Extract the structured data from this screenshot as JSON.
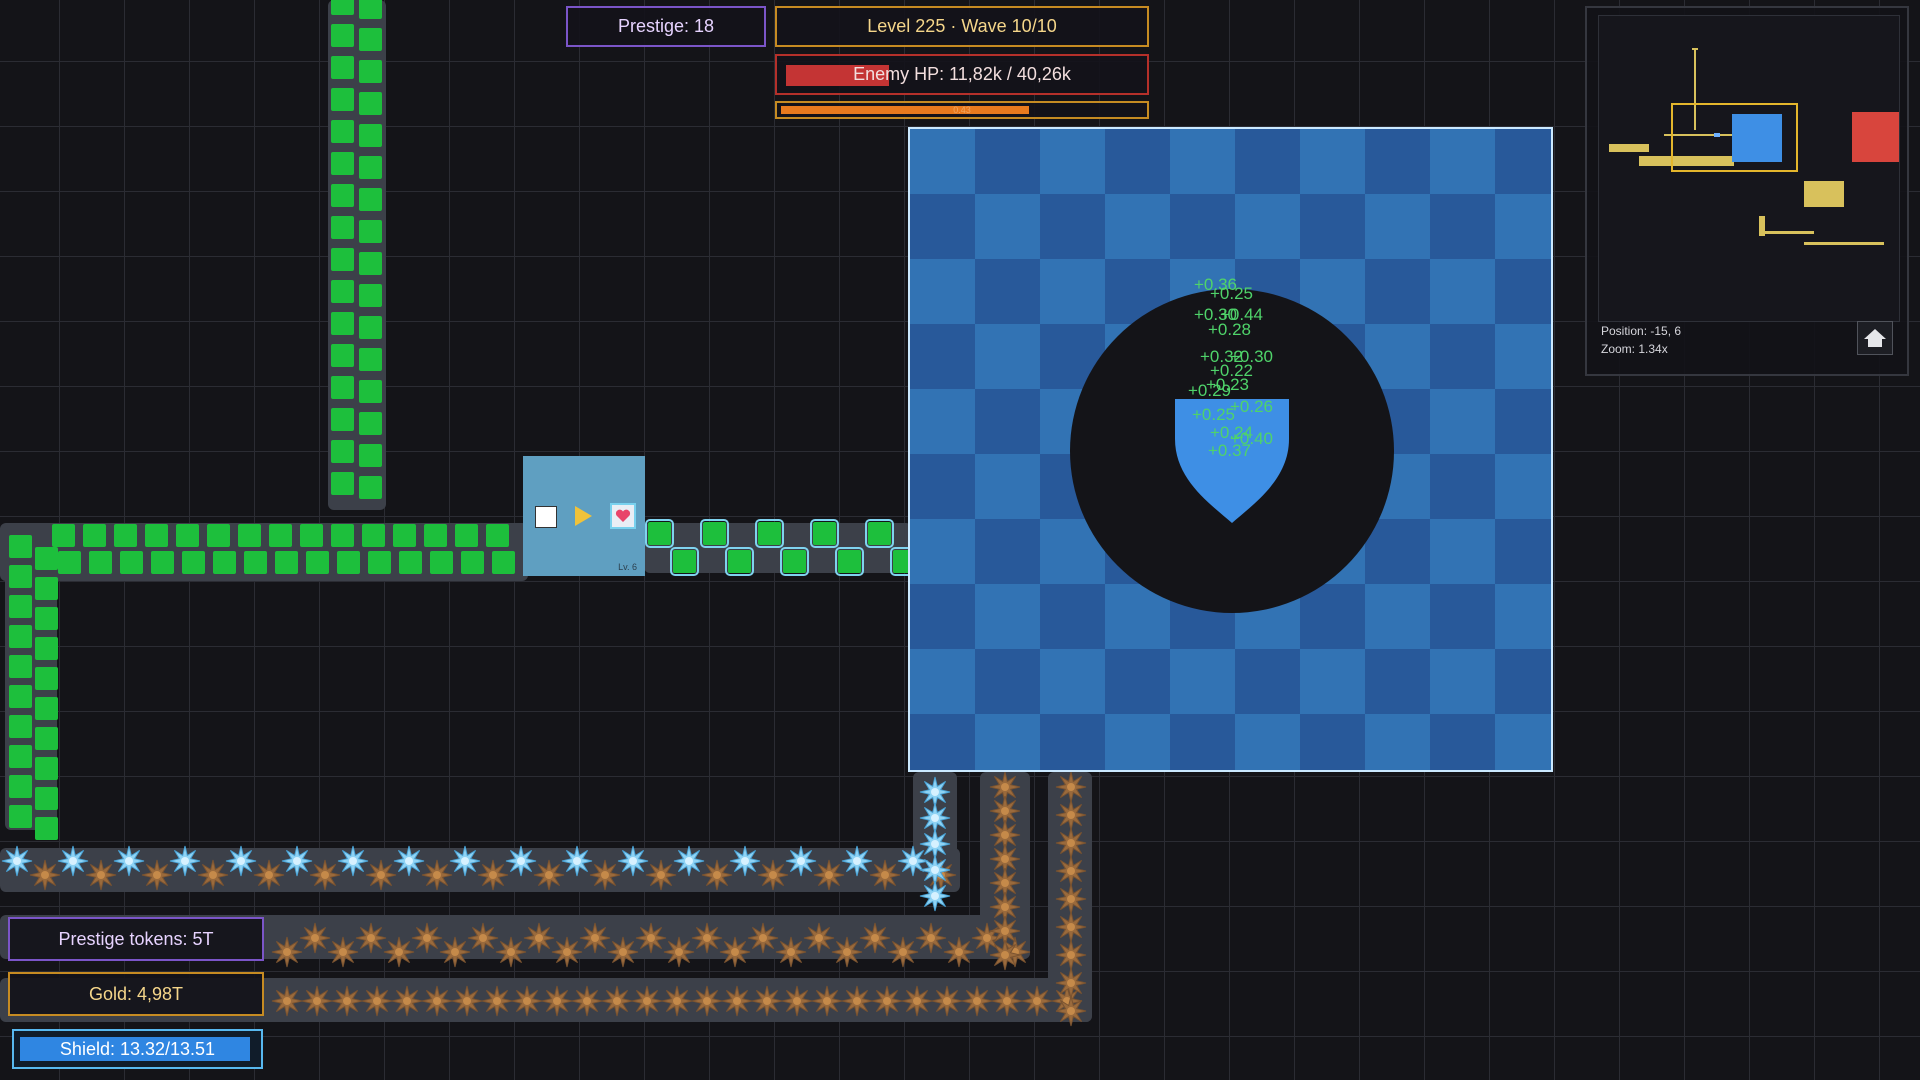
{
  "hud": {
    "prestige": "Prestige: 18",
    "level_wave": "Level 225 · Wave 10/10",
    "enemy_hp": "Enemy HP: 11,82k / 40,26k",
    "enemy_hp_fraction": 0.29,
    "wave_timer": "0.43",
    "wave_progress_fraction": 0.68,
    "prestige_tokens": "Prestige tokens: 5T",
    "gold": "Gold: 4,98T",
    "shield": "Shield: 13.32/13.51",
    "shield_fraction": 0.986
  },
  "factory": {
    "level_label": "Lv. 6"
  },
  "damage_numbers": [
    "+0.36",
    "+0.25",
    "+0.30",
    "+0.44",
    "+0.28",
    "+0.32",
    "+0.30",
    "+0.22",
    "+0.23",
    "+0.29",
    "+0.26",
    "+0.25",
    "+0.24",
    "+0.40",
    "+0.37"
  ],
  "minimap": {
    "position": "Position: -15, 6",
    "zoom": "Zoom: 1.34x"
  },
  "icons": {
    "home": "home-icon",
    "heart": "heart-icon",
    "play": "play-icon",
    "spike": "spike-tower-icon"
  },
  "colors": {
    "tile_green": "#1dbf3c",
    "boss_light": "#3273b4",
    "boss_dark": "#28599a",
    "shield_blue": "#3e8fe5",
    "hp_red": "#c43434",
    "gold": "#c68b22",
    "prestige_purple": "#7b55c8"
  }
}
